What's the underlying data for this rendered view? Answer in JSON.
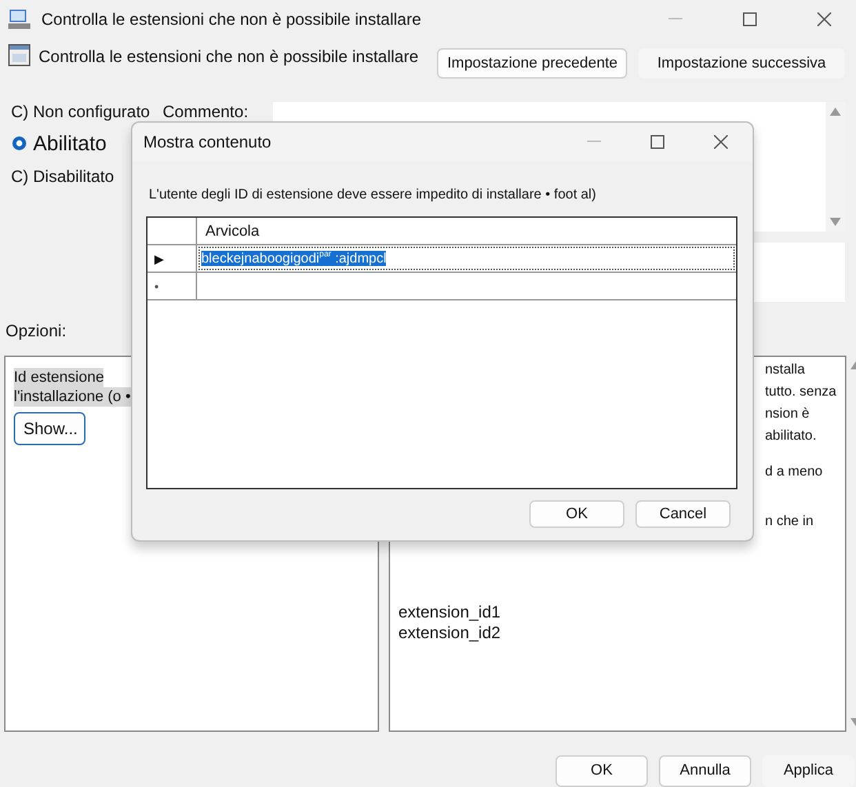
{
  "window": {
    "title": "Controlla le estensioni che non è possibile installare"
  },
  "header": {
    "title": "Controlla le estensioni che non è possibile installare",
    "buttons": [
      "Impostazione precedente",
      "Impostazione successiva"
    ]
  },
  "radios": [
    {
      "label": "C) Non configurato",
      "selected": false
    },
    {
      "label": "Abilitato",
      "selected": true
    },
    {
      "label": "C) Disabilitato",
      "selected": false
    }
  ],
  "comment": {
    "label": "Commento:"
  },
  "options": {
    "label": "Opzioni:",
    "lines": [
      "Id estensione",
      "l'installazione (o •"
    ],
    "button": "Show..."
  },
  "help": {
    "fragments": [
      "nstalla",
      "tutto. senza",
      "nsion è",
      "abilitato.",
      "d a meno",
      "n che in"
    ],
    "lines": [
      "extension_id1",
      "extension_id2"
    ]
  },
  "footer": {
    "buttons": [
      "OK",
      "Annulla",
      "Applica"
    ]
  },
  "dialog": {
    "title": "Mostra contenuto",
    "description": "L'utente degli ID di estensione deve essere impedito di installare • foot al)",
    "column": "Arvicola",
    "rows": [
      {
        "marker": "▶",
        "value": "bleckejnaboogigodi$^{par}$ :ajdmpcl",
        "selected": true
      },
      {
        "marker": "•",
        "value": "",
        "selected": false
      }
    ],
    "buttons": [
      "OK",
      "Cancel"
    ]
  }
}
